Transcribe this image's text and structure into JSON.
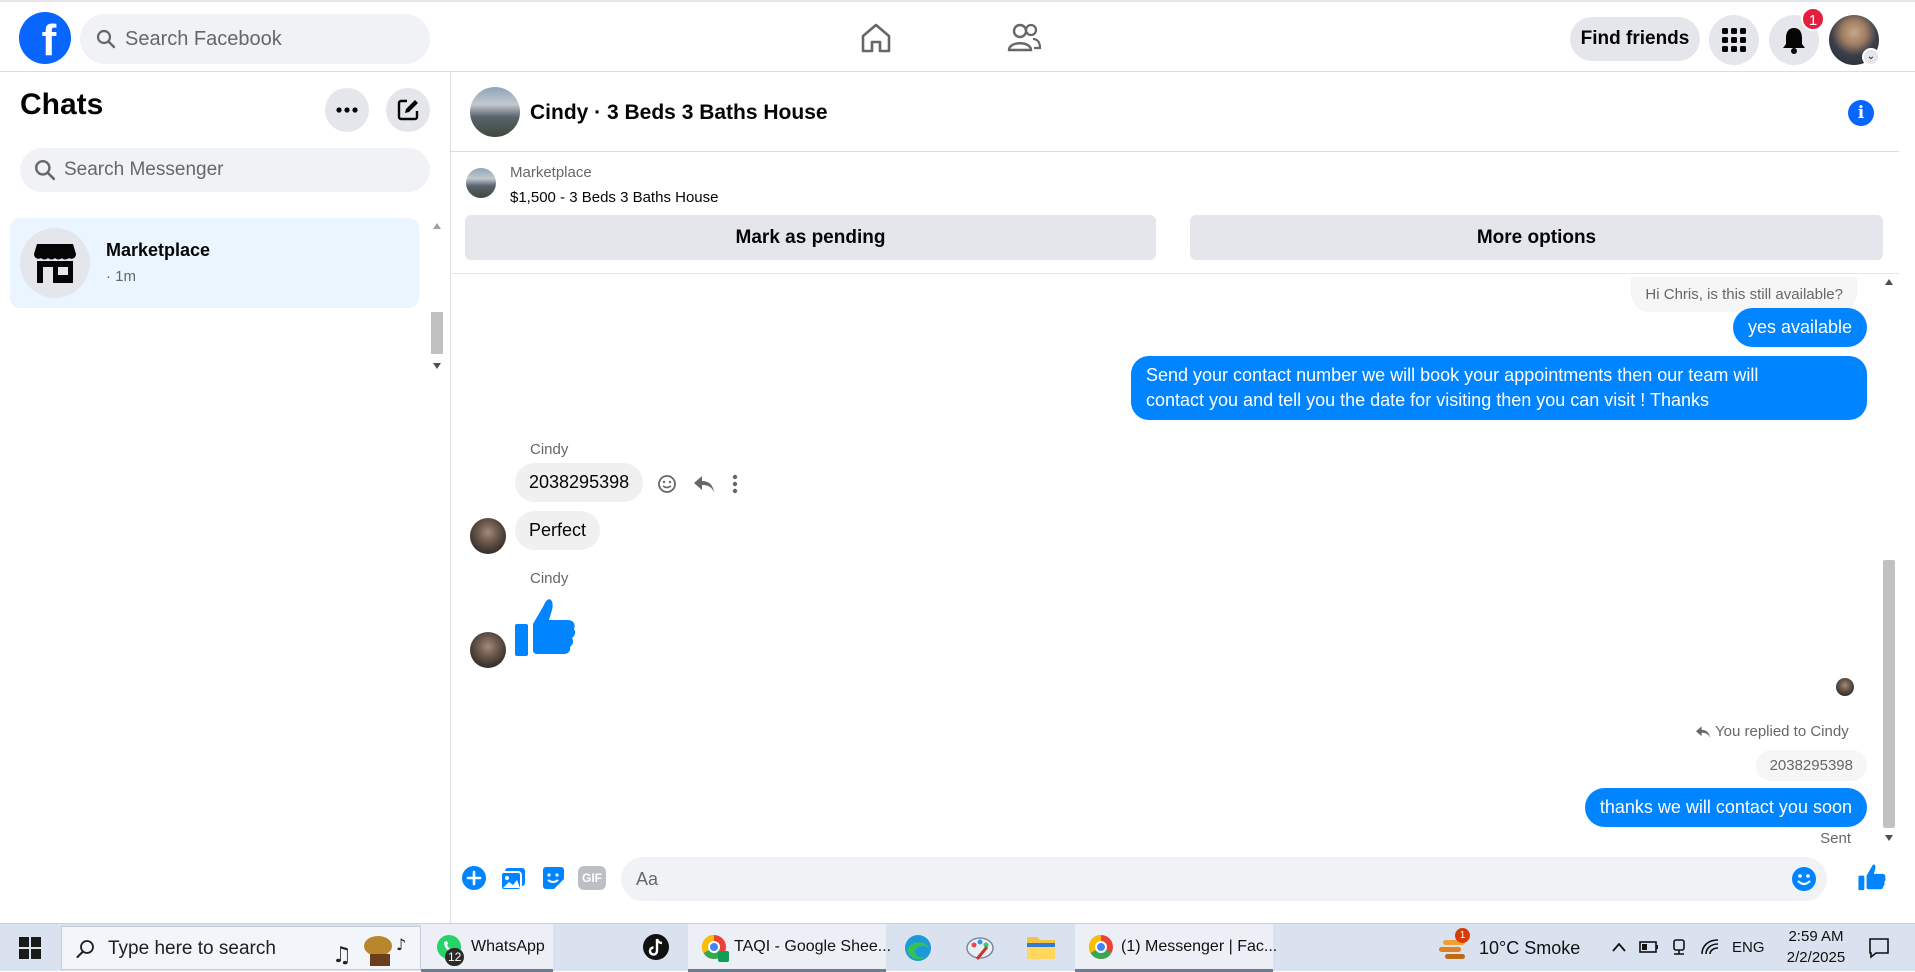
{
  "topnav": {
    "logo_letter": "f",
    "search_placeholder": "Search Facebook",
    "find_friends_label": "Find friends",
    "notification_count": "1"
  },
  "left": {
    "title": "Chats",
    "search_placeholder": "Search Messenger",
    "chats": [
      {
        "name": "Marketplace",
        "meta": "· 1m"
      }
    ]
  },
  "conversation": {
    "title": "Cindy · 3 Beds 3 Baths House",
    "marketplace_label": "Marketplace",
    "listing": "$1,500 - 3 Beds 3 Baths House",
    "mark_pending_label": "Mark as pending",
    "more_options_label": "More options",
    "messages": {
      "quoted_first": "Hi Chris, is this still available?",
      "out_1": "yes available",
      "out_2_line1": "Send your contact number we will book your appointments then our team will",
      "out_2_line2": "contact you and tell you the date for visiting then you can visit ! Thanks",
      "sender_1": "Cindy",
      "in_1": "2038295398",
      "in_2": "Perfect",
      "sender_2": "Cindy",
      "replied_label": "You replied to Cindy",
      "quoted_reply": "2038295398",
      "out_3": "thanks we will contact you soon",
      "status": "Sent"
    },
    "composer_placeholder": "Aa",
    "gif_label": "GIF"
  },
  "taskbar": {
    "search_placeholder": "Type here to search",
    "apps": [
      {
        "label": "WhatsApp",
        "badge": "12"
      },
      {
        "label": ""
      },
      {
        "label": "TAQI - Google Shee..."
      },
      {
        "label": ""
      },
      {
        "label": ""
      },
      {
        "label": ""
      },
      {
        "label": "(1) Messenger | Fac..."
      }
    ],
    "weather": "10°C  Smoke",
    "weather_badge": "1",
    "language": "ENG",
    "time": "2:59 AM",
    "date": "2/2/2025"
  },
  "colors": {
    "facebook_blue": "#0866ff",
    "messenger_bubble": "#0084ff",
    "badge_red": "#e41e3f"
  }
}
